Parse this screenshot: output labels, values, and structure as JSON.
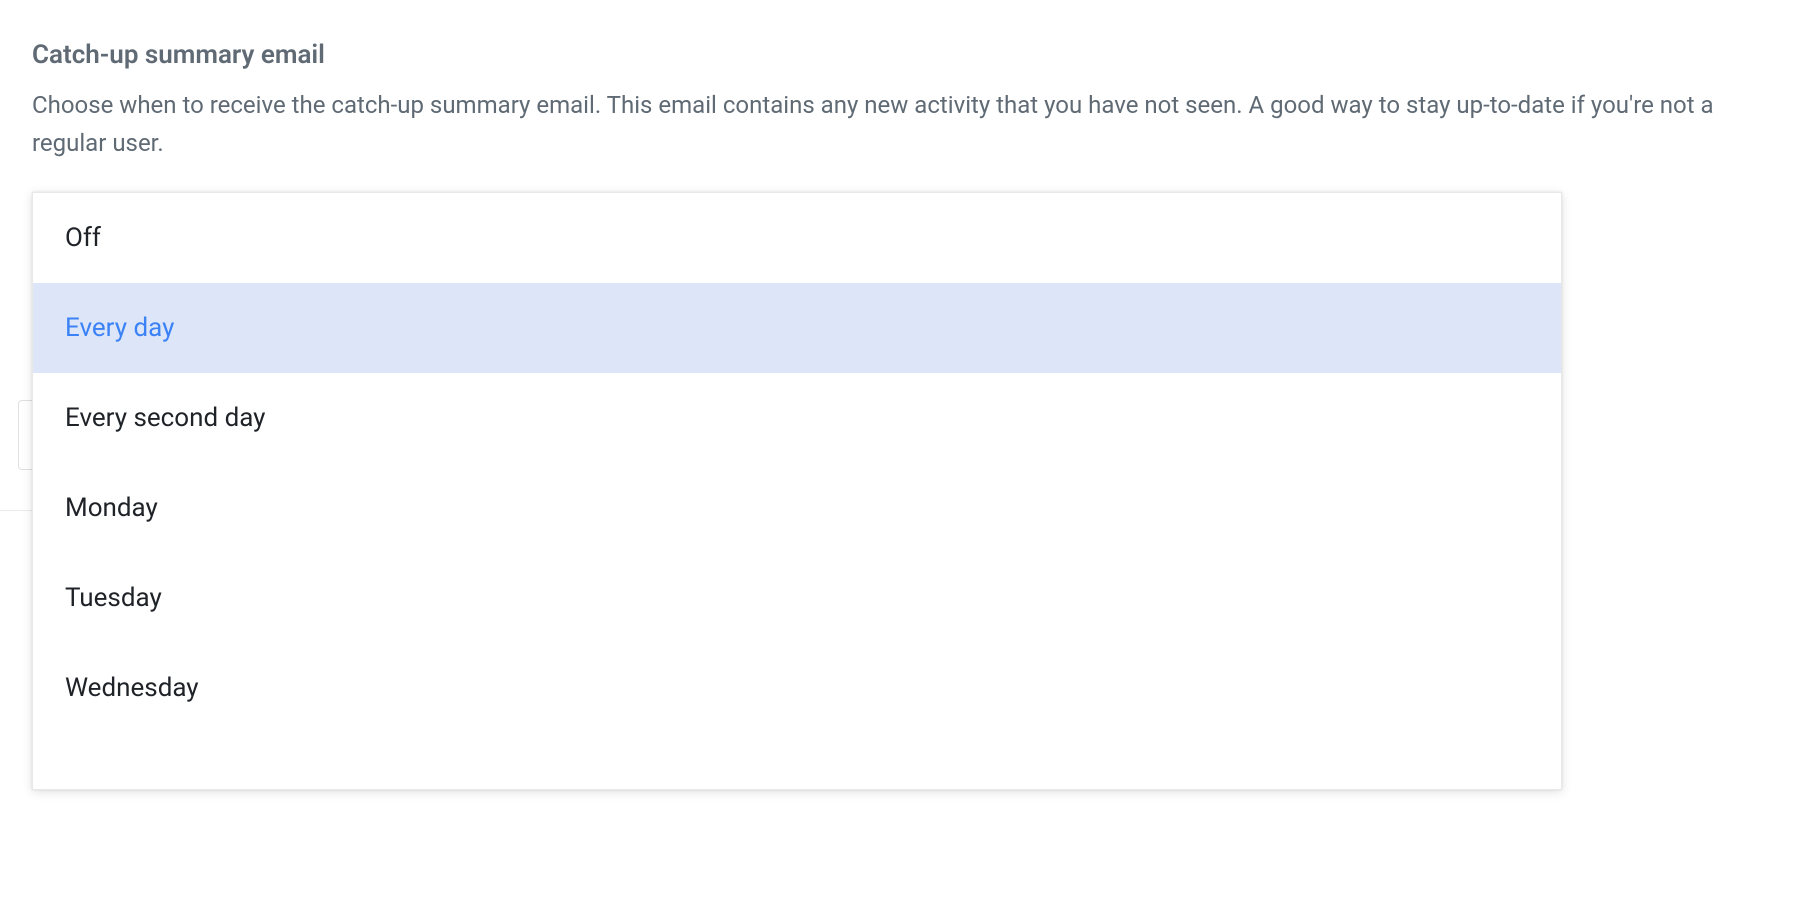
{
  "section": {
    "title": "Catch-up summary email",
    "description": "Choose when to receive the catch-up summary email. This email contains any new activity that you have not seen. A good way to stay up-to-date if you're not a regular user."
  },
  "dropdown": {
    "selected_index": 1,
    "options": [
      {
        "label": "Off"
      },
      {
        "label": "Every day"
      },
      {
        "label": "Every second day"
      },
      {
        "label": "Monday"
      },
      {
        "label": "Tuesday"
      },
      {
        "label": "Wednesday"
      }
    ]
  }
}
